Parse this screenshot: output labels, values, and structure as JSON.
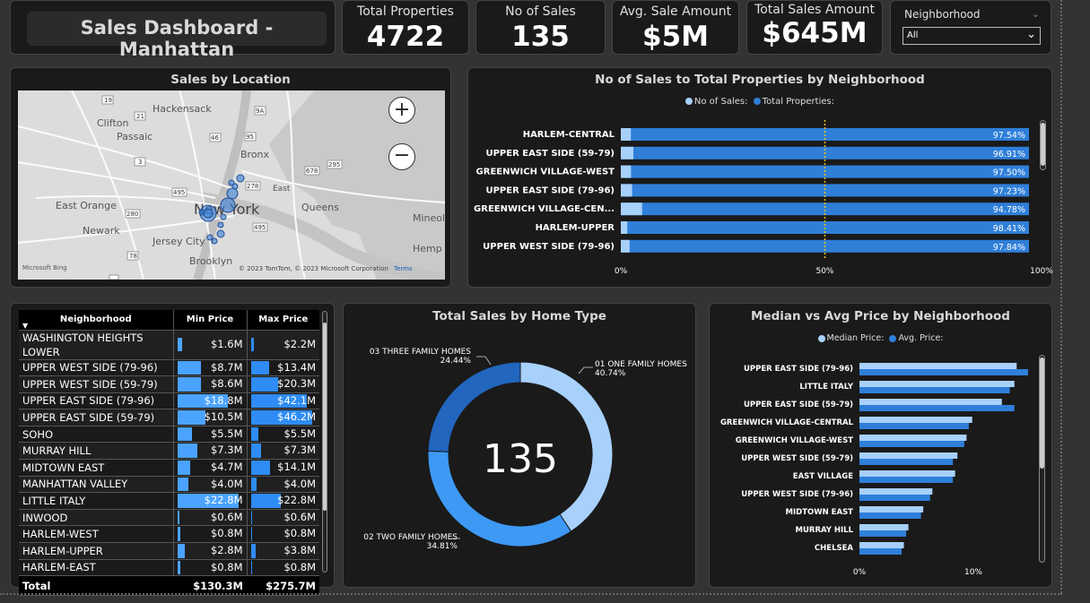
{
  "header": {
    "title": "Sales Dashboard - Manhattan"
  },
  "kpis": [
    {
      "label": "Total Properties",
      "value": "4722"
    },
    {
      "label": "No of Sales",
      "value": "135"
    },
    {
      "label": "Avg. Sale Amount",
      "value": "$5M"
    },
    {
      "label": "Total Sales Amount",
      "value": "$645M"
    }
  ],
  "filter": {
    "label": "Neighborhood",
    "selected": "All"
  },
  "map": {
    "title": "Sales by Location",
    "labels": [
      "Hackensack",
      "Clifton",
      "Passaic",
      "Bronx",
      "East Orange",
      "Newark",
      "New York",
      "Jersey City",
      "Queens",
      "Brooklyn",
      "East",
      "Mineol",
      "Hemp"
    ],
    "route_numbers": [
      "19",
      "21",
      "9A",
      "3",
      "46",
      "95",
      "495",
      "280",
      "278",
      "678",
      "295",
      "78",
      "1",
      "495"
    ],
    "attribution": "© 2023 TomTom, © 2023 Microsoft Corporation",
    "terms": "Terms",
    "bing": "Microsoft Bing"
  },
  "sales_ratio": {
    "title": "No of Sales to Total Properties by Neighborhood",
    "legend": [
      "No of Sales:",
      "Total Properties:"
    ],
    "rows": [
      {
        "name": "HARLEM-CENTRAL",
        "pct": "97.54%",
        "value": 97.54
      },
      {
        "name": "UPPER EAST SIDE (59-79)",
        "pct": "96.91%",
        "value": 96.91
      },
      {
        "name": "GREENWICH VILLAGE-WEST",
        "pct": "97.50%",
        "value": 97.5
      },
      {
        "name": "UPPER EAST SIDE (79-96)",
        "pct": "97.23%",
        "value": 97.23
      },
      {
        "name": "GREENWICH VILLAGE-CEN...",
        "pct": "94.78%",
        "value": 94.78
      },
      {
        "name": "HARLEM-UPPER",
        "pct": "98.41%",
        "value": 98.41
      },
      {
        "name": "UPPER WEST SIDE (79-96)",
        "pct": "97.84%",
        "value": 97.84
      }
    ],
    "axis": [
      "0%",
      "50%",
      "100%"
    ]
  },
  "price_table": {
    "headers": [
      "Neighborhood",
      "Min Price",
      "Max Price"
    ],
    "rows": [
      {
        "name": "WASHINGTON HEIGHTS LOWER",
        "min": "$1.6M",
        "max": "$2.2M",
        "min_frac": 0.07,
        "max_frac": 0.05
      },
      {
        "name": "UPPER WEST SIDE (79-96)",
        "min": "$8.7M",
        "max": "$13.4M",
        "min_frac": 0.38,
        "max_frac": 0.29
      },
      {
        "name": "UPPER WEST SIDE (59-79)",
        "min": "$8.6M",
        "max": "$20.3M",
        "min_frac": 0.38,
        "max_frac": 0.44
      },
      {
        "name": "UPPER EAST SIDE (79-96)",
        "min": "$18.8M",
        "max": "$42.1M",
        "min_frac": 0.82,
        "max_frac": 0.91
      },
      {
        "name": "UPPER EAST SIDE (59-79)",
        "min": "$10.5M",
        "max": "$46.2M",
        "min_frac": 0.46,
        "max_frac": 1.0
      },
      {
        "name": "SOHO",
        "min": "$5.5M",
        "max": "$5.5M",
        "min_frac": 0.24,
        "max_frac": 0.12
      },
      {
        "name": "MURRAY HILL",
        "min": "$7.3M",
        "max": "$7.3M",
        "min_frac": 0.32,
        "max_frac": 0.16
      },
      {
        "name": "MIDTOWN EAST",
        "min": "$4.7M",
        "max": "$14.1M",
        "min_frac": 0.21,
        "max_frac": 0.31
      },
      {
        "name": "MANHATTAN VALLEY",
        "min": "$4.0M",
        "max": "$4.0M",
        "min_frac": 0.18,
        "max_frac": 0.09
      },
      {
        "name": "LITTLE ITALY",
        "min": "$22.8M",
        "max": "$22.8M",
        "min_frac": 1.0,
        "max_frac": 0.49
      },
      {
        "name": "INWOOD",
        "min": "$0.6M",
        "max": "$0.6M",
        "min_frac": 0.03,
        "max_frac": 0.01
      },
      {
        "name": "HARLEM-WEST",
        "min": "$0.8M",
        "max": "$0.8M",
        "min_frac": 0.04,
        "max_frac": 0.02
      },
      {
        "name": "HARLEM-UPPER",
        "min": "$2.8M",
        "max": "$3.8M",
        "min_frac": 0.12,
        "max_frac": 0.08
      },
      {
        "name": "HARLEM-EAST",
        "min": "$0.8M",
        "max": "$0.8M",
        "min_frac": 0.04,
        "max_frac": 0.02
      }
    ],
    "total": {
      "name": "Total",
      "min": "$130.3M",
      "max": "$275.7M"
    }
  },
  "donut": {
    "title": "Total Sales by Home Type",
    "center": "135",
    "slices": [
      {
        "name": "01 ONE FAMILY HOMES",
        "pct": "40.74%",
        "value": 40.74,
        "color": "#a7d0fb"
      },
      {
        "name": "02 TWO FAMILY HOMES",
        "pct": "34.81%",
        "value": 34.81,
        "color": "#3e99f5"
      },
      {
        "name": "03 THREE FAMILY HOMES",
        "pct": "24.44%",
        "value": 24.44,
        "color": "#2266bf"
      }
    ]
  },
  "median_avg": {
    "title": "Median vs Avg Price by Neighborhood",
    "legend": [
      "Median Price:",
      "Avg. Price:"
    ],
    "rows": [
      {
        "name": "UPPER EAST SIDE (79-96)",
        "median": 13.8,
        "avg": 14.8
      },
      {
        "name": "LITTLE ITALY",
        "median": 13.6,
        "avg": 13.2
      },
      {
        "name": "UPPER EAST SIDE (59-79)",
        "median": 12.5,
        "avg": 13.6
      },
      {
        "name": "GREENWICH VILLAGE-CENTRAL",
        "median": 9.9,
        "avg": 9.6
      },
      {
        "name": "GREENWICH VILLAGE-WEST",
        "median": 9.4,
        "avg": 9.2
      },
      {
        "name": "UPPER WEST SIDE (59-79)",
        "median": 8.6,
        "avg": 8.2
      },
      {
        "name": "EAST VILLAGE",
        "median": 8.4,
        "avg": 8.2
      },
      {
        "name": "UPPER WEST SIDE (79-96)",
        "median": 6.4,
        "avg": 6.2
      },
      {
        "name": "MIDTOWN EAST",
        "median": 5.6,
        "avg": 5.4
      },
      {
        "name": "MURRAY HILL",
        "median": 4.3,
        "avg": 4.1
      },
      {
        "name": "CHELSEA",
        "median": 3.9,
        "avg": 3.7
      }
    ],
    "axis": [
      "0%",
      "10%"
    ],
    "colors": {
      "median": "#a7d0fb",
      "avg": "#2f7fd9"
    }
  },
  "colors": {
    "accent": "#2f7fd9",
    "light": "#a7d0fb",
    "panel": "#1a1a1a",
    "background": "#333333",
    "ref_line": "#f0c419"
  }
}
